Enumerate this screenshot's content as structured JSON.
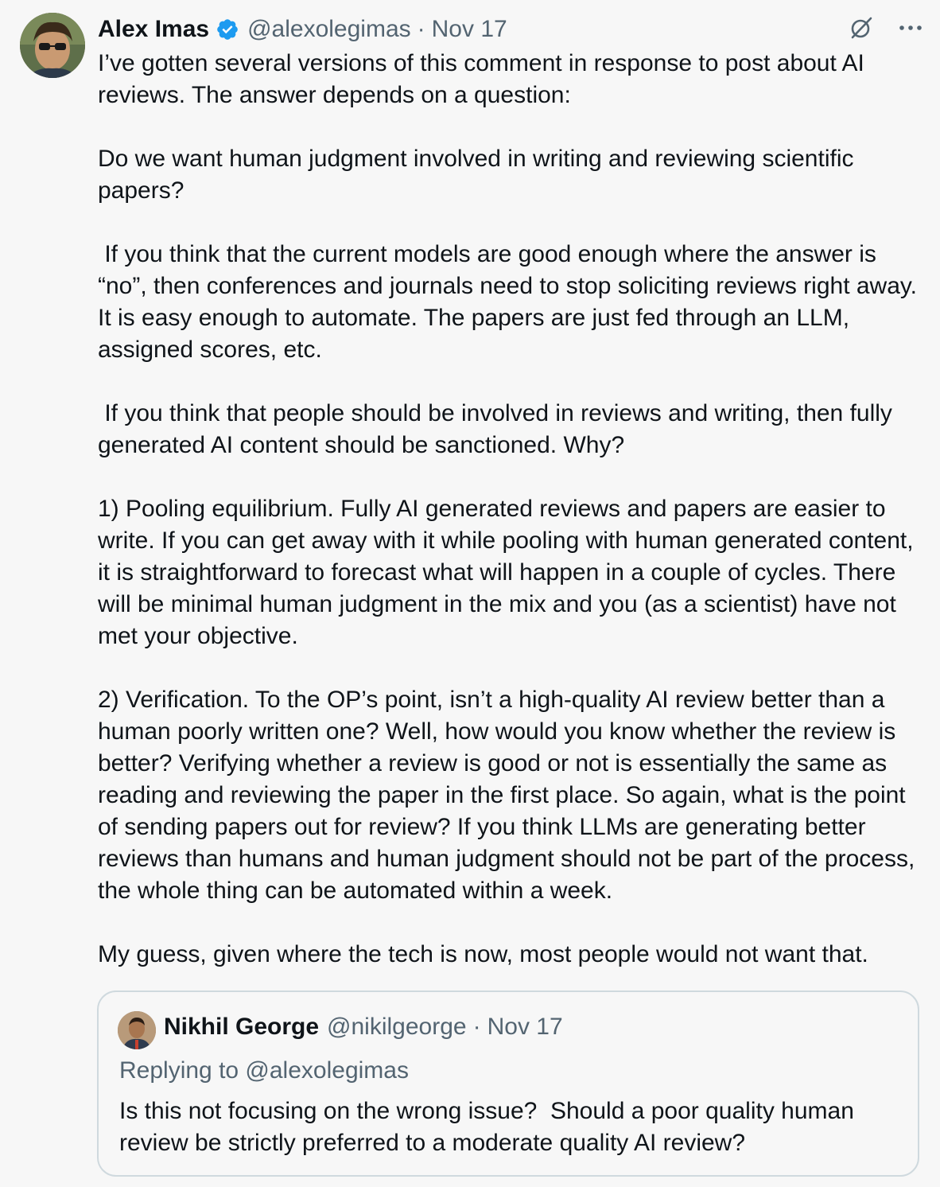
{
  "tweet": {
    "author_name": "Alex Imas",
    "handle": "@alexolegimas",
    "separator": "·",
    "date": "Nov 17",
    "body": "I’ve gotten several versions of this comment in response to post about AI reviews. The answer depends on a question:\n\nDo we want human judgment involved in writing and reviewing scientific papers?\n\n If you think that the current models are good enough where the answer is “no”, then conferences and journals need to stop soliciting reviews right away. It is easy enough to automate. The papers are just fed through an LLM, assigned scores, etc.\n\n If you think that people should be involved in reviews and writing, then fully generated AI content should be sanctioned. Why?\n\n1) Pooling equilibrium. Fully AI generated reviews and papers are easier to write. If you can get away with it while pooling with human generated content, it is straightforward to forecast what will happen in a couple of cycles. There will be minimal human judgment in the mix and you (as a scientist) have not met your objective.\n\n2) Verification. To the OP’s point, isn’t a high-quality AI review better than a human poorly written one? Well, how would you know whether the review is better? Verifying whether a review is good or not is essentially the same as reading and reviewing the paper in the first place. So again, what is the point of sending papers out for review? If you think LLMs are generating better reviews than humans and human judgment should not be part of the process, the whole thing can be automated within a week.\n\nMy guess, given where the tech is now, most people would not want that."
  },
  "quoted": {
    "author_name": "Nikhil George",
    "handle": "@nikilgeorge",
    "separator": "·",
    "date": "Nov 17",
    "replying_to": "Replying to @alexolegimas",
    "body": "Is this not focusing on the wrong issue?  Should a poor quality human review be strictly preferred to a moderate quality AI review?"
  },
  "icons": {
    "verified": "verified-badge-icon",
    "grok": "grok-icon",
    "more": "more-icon"
  },
  "colors": {
    "background": "#f7f7f7",
    "text": "#0f1419",
    "secondary_text": "#536471",
    "verified_blue": "#1d9bf0",
    "border": "#cfd9de"
  }
}
